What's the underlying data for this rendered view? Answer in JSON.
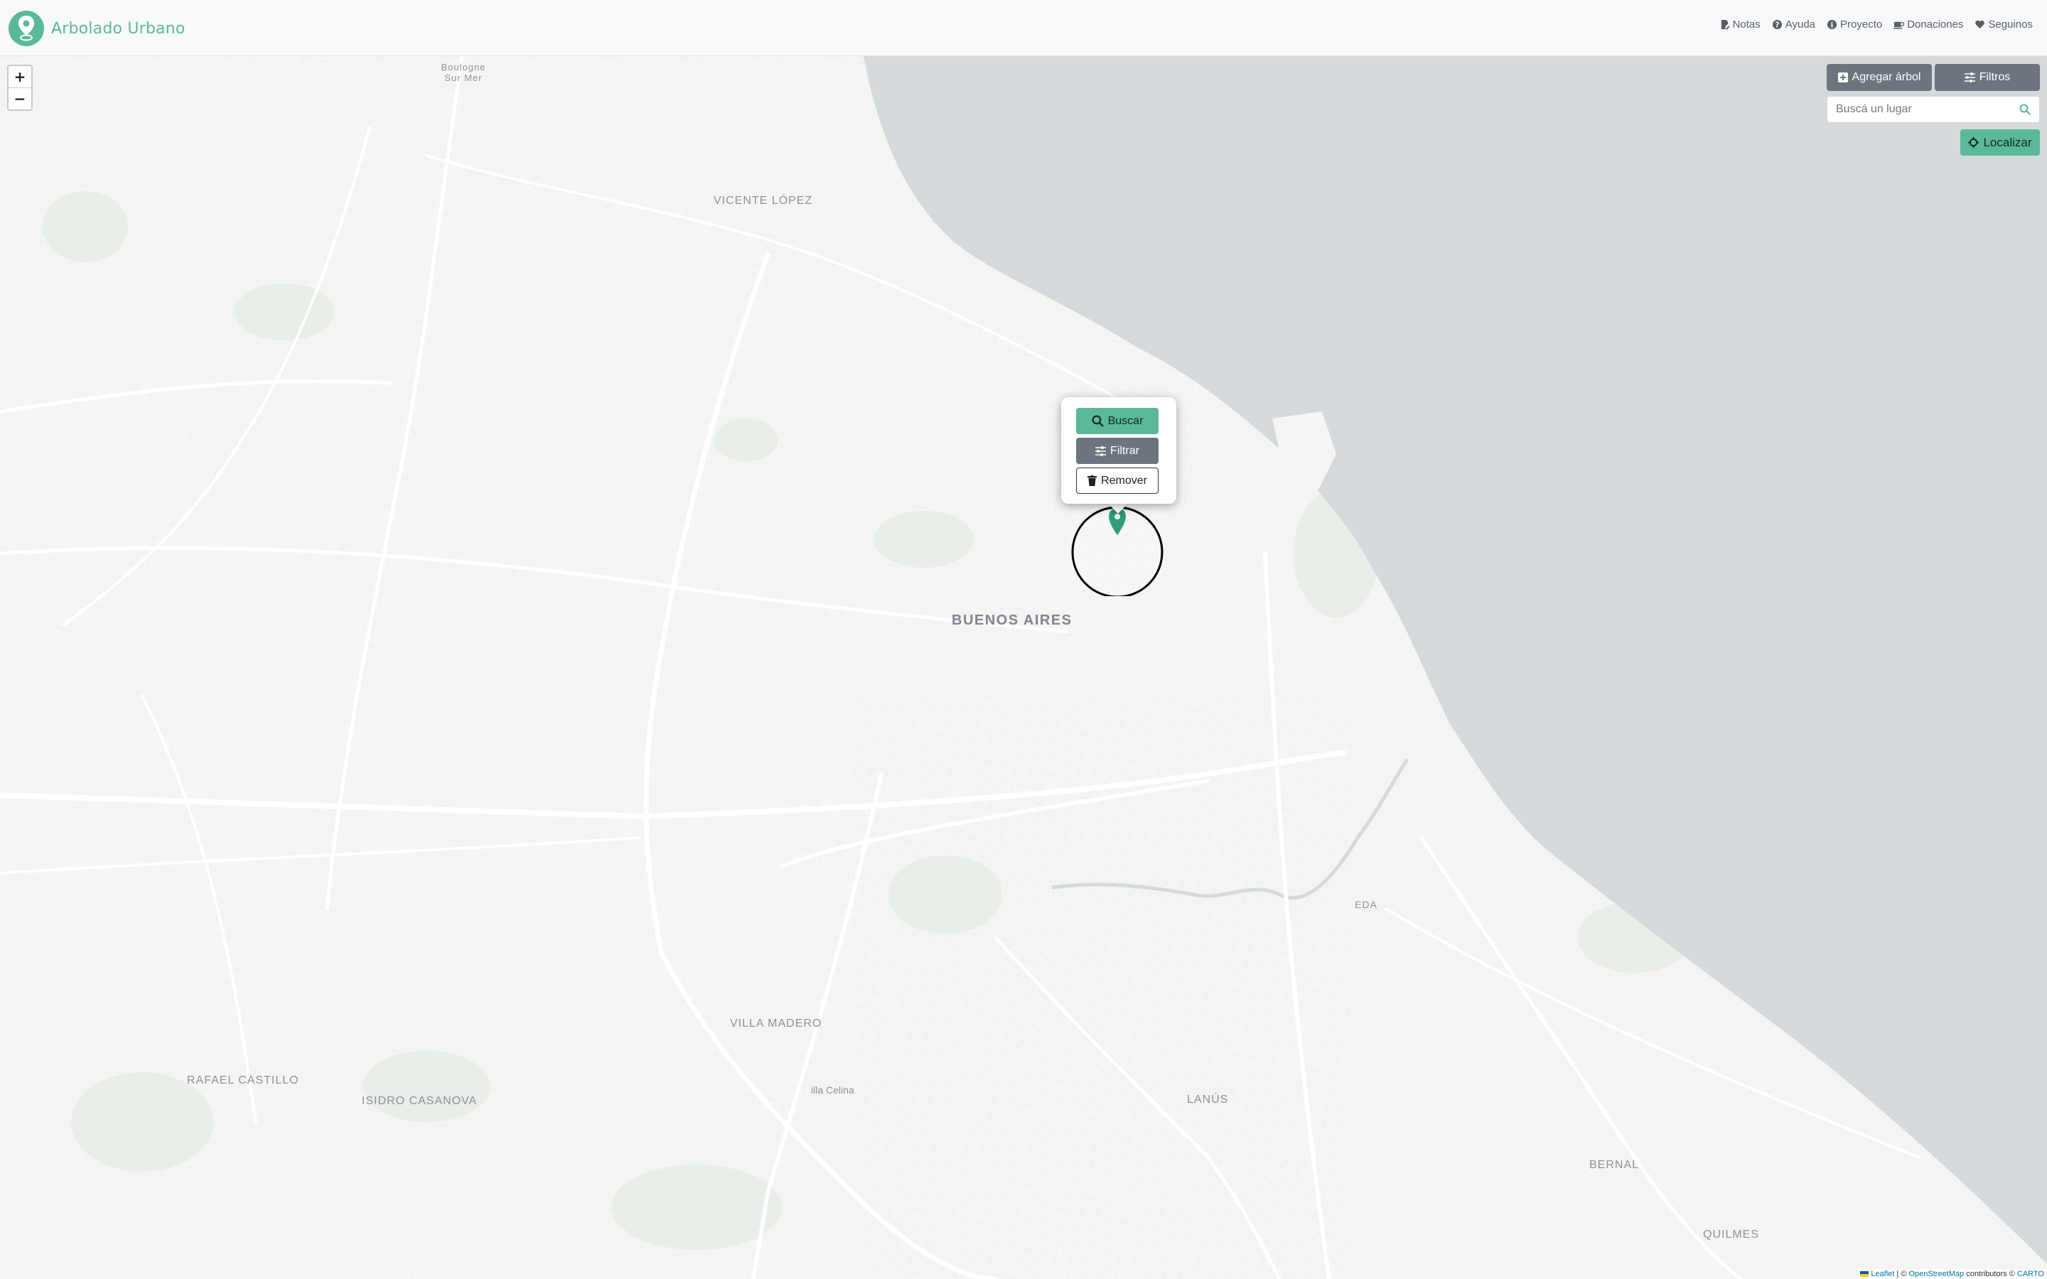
{
  "brand": {
    "name": "Arbolado Urbano"
  },
  "nav": {
    "items": [
      {
        "label": "Notas",
        "icon": "file-pen-icon"
      },
      {
        "label": "Ayuda",
        "icon": "question-circle-icon"
      },
      {
        "label": "Proyecto",
        "icon": "info-circle-icon"
      },
      {
        "label": "Donaciones",
        "icon": "coffee-icon"
      },
      {
        "label": "Seguinos",
        "icon": "heart-icon"
      }
    ]
  },
  "map": {
    "zoom_in": "+",
    "zoom_out": "−",
    "labels": {
      "boulogne": "Boulogne Sur Mer",
      "vicente_lopez": "VICENTE LÓPEZ",
      "buenos_aires": "BUENOS AIRES",
      "villa_madero": "VILLA MADERO",
      "rafael_castillo": "RAFAEL CASTILLO",
      "isidro_casanova": "ISIDRO CASANOVA",
      "villa_celina": "illa Celina",
      "lanus": "LANÚS",
      "eda": "EDA",
      "bernal": "BERNAL",
      "quilmes": "QUILMES"
    },
    "attribution": {
      "leaflet": "Leaflet",
      "sep1": " | © ",
      "osm": "OpenStreetMap",
      "sep2": " contributors © ",
      "carto": "CARTO"
    }
  },
  "controls": {
    "add_tree": "Agregar árbol",
    "filters": "Filtros",
    "search_placeholder": "Buscá un lugar",
    "locate": "Localizar"
  },
  "popup": {
    "search": "Buscar",
    "filter": "Filtrar",
    "remove": "Remover"
  },
  "colors": {
    "brand": "#5bb89a",
    "water": "#d4dadc",
    "gray_button": "#6c757d"
  }
}
